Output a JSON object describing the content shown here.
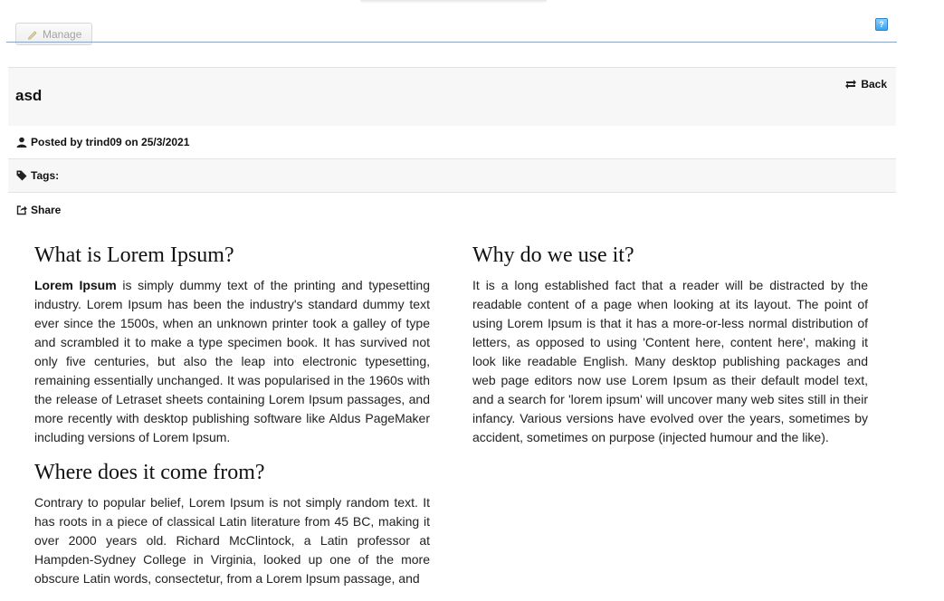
{
  "toolbar": {
    "manage_label": "Manage",
    "help_icon": "help-icon",
    "help_glyph": "?"
  },
  "post": {
    "title": "asd",
    "back_label": "Back",
    "posted_by": "Posted by trind09 on 25/3/2021",
    "tags_label": "Tags:",
    "share_label": "Share"
  },
  "sections": {
    "what": {
      "heading": "What is Lorem Ipsum?",
      "bold_lead": "Lorem Ipsum",
      "body": " is simply dummy text of the printing and typesetting industry. Lorem Ipsum has been the industry's standard dummy text ever since the 1500s, when an unknown printer took a galley of type and scrambled it to make a type specimen book. It has survived not only five centuries, but also the leap into electronic typesetting, remaining essentially unchanged. It was popularised in the 1960s with the release of Letraset sheets containing Lorem Ipsum passages, and more recently with desktop publishing software like Aldus PageMaker including versions of Lorem Ipsum."
    },
    "where": {
      "heading": "Where does it come from?",
      "body": "Contrary to popular belief, Lorem Ipsum is not simply random text. It has roots in a piece of classical Latin literature from 45 BC, making it over 2000 years old. Richard McClintock, a Latin professor at Hampden-Sydney College in Virginia, looked up one of the more obscure Latin words, consectetur, from a Lorem Ipsum passage, and"
    },
    "why": {
      "heading": "Why do we use it?",
      "body": "It is a long established fact that a reader will be distracted by the readable content of a page when looking at its layout. The point of using Lorem Ipsum is that it has a more-or-less normal distribution of letters, as opposed to using 'Content here, content here', making it look like readable English. Many desktop publishing packages and web page editors now use Lorem Ipsum as their default model text, and a search for 'lorem ipsum' will uncover many web sites still in their infancy. Various versions have evolved over the years, sometimes by accident, sometimes on purpose (injected humour and the like)."
    }
  },
  "colors": {
    "accent_line": "#8aa4c8",
    "panel_bg": "#f7f7f7",
    "border": "#e3e3e3"
  }
}
